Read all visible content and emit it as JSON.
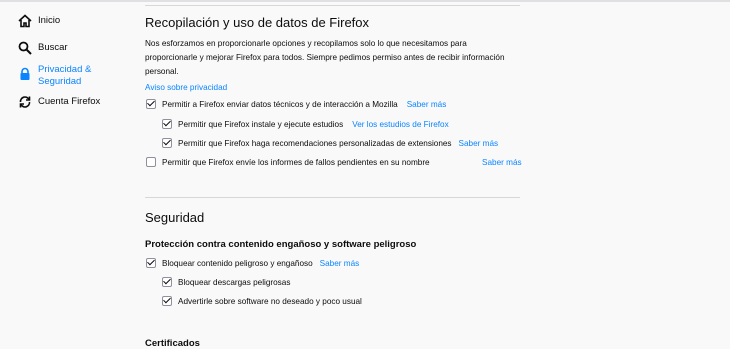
{
  "sidebar": {
    "items": [
      {
        "label": "Inicio",
        "icon": "home-icon"
      },
      {
        "label": "Buscar",
        "icon": "search-icon"
      },
      {
        "label": "Privacidad & Seguridad",
        "icon": "lock-icon",
        "selected": true
      },
      {
        "label": "Cuenta Firefox",
        "icon": "sync-icon"
      }
    ]
  },
  "data_collection": {
    "title": "Recopilación y uso de datos de Firefox",
    "description": "Nos esforzamos en proporcionarle opciones y recopilamos solo lo que necesitamos para proporcionarle y mejorar Firefox para todos. Siempre pedimos permiso antes de recibir información personal.",
    "privacy_link": "Aviso sobre privacidad",
    "options": [
      {
        "label": "Permitir a Firefox enviar datos técnicos y de interacción a Mozilla",
        "checked": true,
        "link": "Saber más"
      },
      {
        "label": "Permitir que Firefox instale y ejecute estudios",
        "checked": true,
        "link": "Ver los estudios de Firefox"
      },
      {
        "label": "Permitir que Firefox haga recomendaciones personalizadas de extensiones",
        "checked": true,
        "link": "Saber más"
      },
      {
        "label": "Permitir que Firefox envíe los informes de fallos pendientes en su nombre",
        "checked": false,
        "link": "Saber más"
      }
    ]
  },
  "security": {
    "title": "Seguridad",
    "subheading": "Protección contra contenido engañoso y software peligroso",
    "options": [
      {
        "label": "Bloquear contenido peligroso y engañoso",
        "checked": true,
        "link": "Saber más"
      },
      {
        "label": "Bloquear descargas peligrosas",
        "checked": true
      },
      {
        "label": "Advertirle sobre software no deseado y poco usual",
        "checked": true
      }
    ],
    "next_heading": "Certificados"
  },
  "colors": {
    "accent": "#0a84ff",
    "background": "#f9f9fa",
    "text": "#0c0c0d"
  }
}
